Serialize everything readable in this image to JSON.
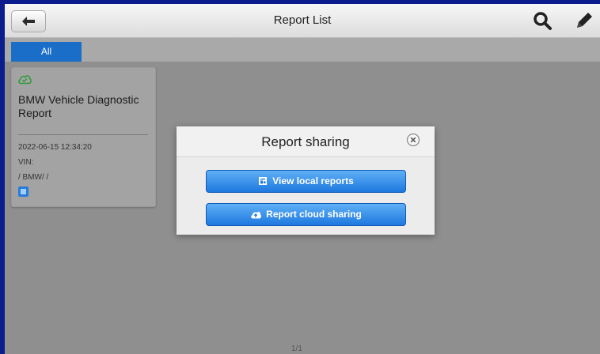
{
  "header": {
    "title": "Report List"
  },
  "tabs": [
    {
      "label": "All",
      "active": true
    }
  ],
  "report_card": {
    "title": "BMW Vehicle Diagnostic Report",
    "date": "2022-06-15 12:34:20",
    "vin": "VIN:",
    "path": "/ BMW/ /",
    "status_icon": "cloud-check-icon",
    "status_color": "#2e9c3a"
  },
  "pagination": {
    "text": "1/1"
  },
  "dialog": {
    "title": "Report sharing",
    "buttons": [
      {
        "label": "View local reports",
        "icon": "local-report-icon"
      },
      {
        "label": "Report cloud sharing",
        "icon": "cloud-upload-icon"
      }
    ]
  },
  "colors": {
    "accent": "#1a6ec7",
    "button_top": "#5fb0f5",
    "button_bottom": "#1e78df",
    "frame": "#0b1d8c"
  }
}
